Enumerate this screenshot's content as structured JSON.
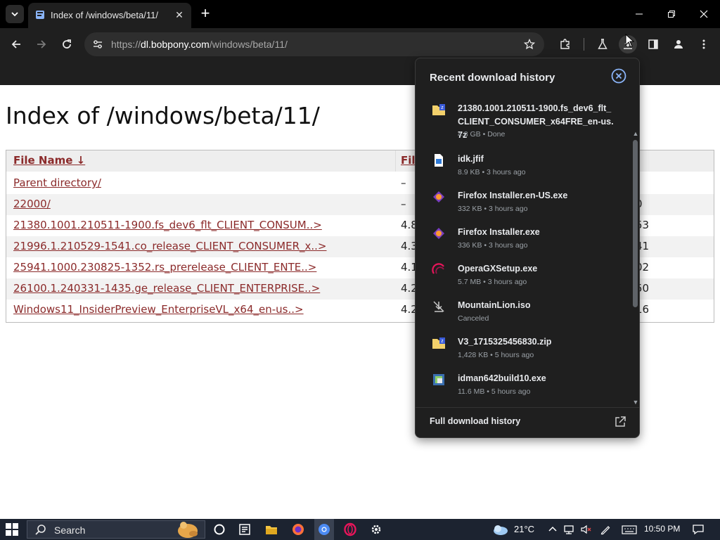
{
  "browser": {
    "tab_title": "Index of /windows/beta/11/",
    "url_scheme": "https://",
    "url_host": "dl.bobpony.com",
    "url_path": "/windows/beta/11/"
  },
  "page": {
    "heading": "Index of /windows/beta/11/",
    "columns": {
      "name": "File Name  ↓",
      "size": "Fil"
    },
    "rows": [
      {
        "name": "Parent directory/",
        "size": "–",
        "date": ""
      },
      {
        "name": "22000/",
        "size": "–",
        "date": "0"
      },
      {
        "name": "21380.1001.210511-1900.fs_dev6_flt_CLIENT_CONSUM..>",
        "size": "4.8",
        "date": "53"
      },
      {
        "name": "21996.1.210529-1541.co_release_CLIENT_CONSUMER_x..>",
        "size": "4.3",
        "date": "41"
      },
      {
        "name": "25941.1000.230825-1352.rs_prerelease_CLIENT_ENTE..>",
        "size": "4.1",
        "date": "02"
      },
      {
        "name": "26100.1.240331-1435.ge_release_CLIENT_ENTERPRISE..>",
        "size": "4.2",
        "date": "50"
      },
      {
        "name": "Windows11_InsiderPreview_EnterpriseVL_x64_en-us..>",
        "size": "4.2",
        "date": "16"
      }
    ]
  },
  "downloads": {
    "title": "Recent download history",
    "items": [
      {
        "name": "21380.1001.210511-1900.fs_dev6_flt_CLIENT_CONSUMER_x64FRE_en-us.7z",
        "status": "4.8 GB • Done",
        "icon": "archive-icon"
      },
      {
        "name": "idk.jfif",
        "status": "8.9 KB • 3 hours ago",
        "icon": "image-file-icon"
      },
      {
        "name": "Firefox Installer.en-US.exe",
        "status": "332 KB • 3 hours ago",
        "icon": "firefox-installer-icon"
      },
      {
        "name": "Firefox Installer.exe",
        "status": "336 KB • 3 hours ago",
        "icon": "firefox-installer-icon"
      },
      {
        "name": "OperaGXSetup.exe",
        "status": "5.7 MB • 3 hours ago",
        "icon": "opera-gx-icon"
      },
      {
        "name": "MountainLion.iso",
        "status": "Canceled",
        "icon": "canceled-download-icon"
      },
      {
        "name": "V3_1715325456830.zip",
        "status": "1,428 KB • 5 hours ago",
        "icon": "archive-icon"
      },
      {
        "name": "idman642build10.exe",
        "status": "11.6 MB • 5 hours ago",
        "icon": "idm-installer-icon"
      }
    ],
    "footer": "Full download history"
  },
  "taskbar": {
    "search_label": "Search",
    "temperature": "21°C",
    "time": "10:50 PM"
  },
  "colors": {
    "page_link": "#8b2a2a",
    "panel_bg": "#1f1f1f",
    "chrome_bg": "#1f1f1f",
    "taskbar_bg": "#1c2330"
  }
}
